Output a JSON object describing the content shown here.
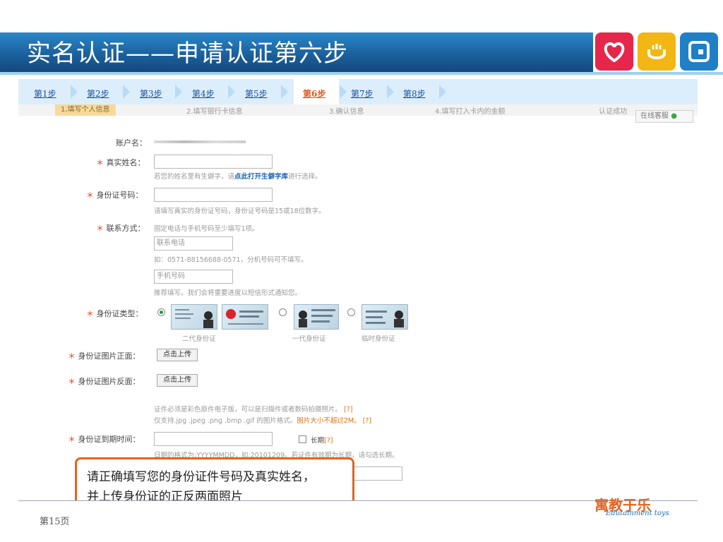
{
  "slide": {
    "title": "实名认证——申请认证第六步",
    "page_number": "第15页",
    "brand_cn": "寓教于乐",
    "brand_en": "Edutainment toys",
    "banner_color": "#1a5e9a",
    "app_icons": [
      {
        "name": "heart-icon",
        "color": "#e6264a",
        "glyph": "♡"
      },
      {
        "name": "hand-icon",
        "color": "#f2b714",
        "glyph": "☚"
      },
      {
        "name": "square-icon",
        "color": "#1f7fc7",
        "glyph": "▣"
      }
    ]
  },
  "steps": [
    {
      "label": "第1步"
    },
    {
      "label": "第2步"
    },
    {
      "label": "第3步"
    },
    {
      "label": "第4步"
    },
    {
      "label": "第5步"
    },
    {
      "label": "第6步",
      "active": true
    },
    {
      "label": "第7步"
    },
    {
      "label": "第8步"
    }
  ],
  "substeps": [
    "1.填写个人信息",
    "2.填写银行卡信息",
    "3.确认信息",
    "4.填写打入卡内的金额",
    "认证成功"
  ],
  "service_button": "在线客服",
  "form": {
    "account_label": "账户名：",
    "real_name_label": "真实姓名：",
    "real_name_hint_prefix": "若您的姓名里有生僻字，请",
    "real_name_hint_link": "点此打开生僻字库",
    "real_name_hint_suffix": "进行选择。",
    "id_number_label": "身份证号码：",
    "id_number_hint": "请填写真实的身份证号码，身份证号码是15或18位数字。",
    "contact_label": "联系方式：",
    "contact_hint": "固定电话与手机号码至少填写1项。",
    "phone_placeholder": "联系电话",
    "phone_hint": "如：0571-88156688-0571，分机号码可不填写。",
    "mobile_placeholder": "手机号码",
    "mobile_hint": "推荐填写。我们会将重要进度以短信形式通知您。",
    "id_type_label": "身份证类型：",
    "id_types": [
      "二代身份证",
      "一代身份证",
      "临时身份证"
    ],
    "id_front_label": "身份证图片正面：",
    "id_back_label": "身份证图片反面：",
    "upload_button": "点击上传",
    "upload_hint_1": "证件必须是彩色原件电子版，可以是扫描件或者数码拍摄照片。",
    "upload_hint_2_prefix": "仅支持.jpg .jpeg .png .bmp .gif 的图片格式。",
    "upload_hint_2_warn": "图片大小不超过2M。",
    "help_mark": "[?]",
    "expiry_label": "身份证到期时间：",
    "long_term_label": "长期",
    "expiry_hint": "日期的格式为:YYYYMMDD，如:20101209。若证件有效期为长期，请勾选长期。"
  },
  "callout": {
    "line1": "请正确填写您的身份证件号码及真实姓名，",
    "line2": "并上传身份证的正反两面照片",
    "border_color": "#e8621e"
  }
}
